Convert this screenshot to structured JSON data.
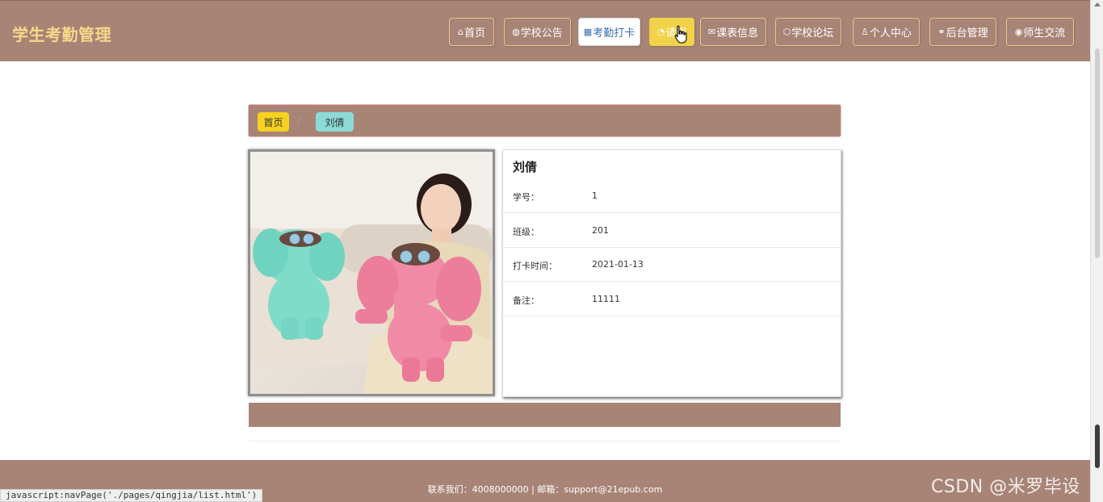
{
  "header": {
    "site_title": "学生考勤管理",
    "nav": [
      {
        "label": "首页",
        "icon": "home-icon",
        "glyph": "⌂",
        "state": "normal"
      },
      {
        "label": "学校公告",
        "icon": "globe-icon",
        "glyph": "◍",
        "state": "normal"
      },
      {
        "label": "考勤打卡",
        "icon": "calendar-icon",
        "glyph": "▦",
        "state": "active"
      },
      {
        "label": "请假",
        "icon": "gauge-icon",
        "glyph": "◔",
        "state": "hover"
      },
      {
        "label": "课表信息",
        "icon": "envelope-icon",
        "glyph": "✉",
        "state": "normal"
      },
      {
        "label": "学校论坛",
        "icon": "cube-icon",
        "glyph": "⬡",
        "state": "normal"
      },
      {
        "label": "个人中心",
        "icon": "user-icon",
        "glyph": "♙",
        "state": "normal"
      },
      {
        "label": "后台管理",
        "icon": "link-icon",
        "glyph": "⚭",
        "state": "normal"
      },
      {
        "label": "师生交流",
        "icon": "compass-icon",
        "glyph": "◉",
        "state": "normal"
      }
    ]
  },
  "breadcrumb": {
    "home": "首页",
    "separator": "/",
    "current": "刘倩"
  },
  "details": {
    "title": "刘倩",
    "rows": [
      {
        "label": "学号：",
        "value": "1"
      },
      {
        "label": "班级：",
        "value": "201"
      },
      {
        "label": "打卡时间：",
        "value": "2021-01-13"
      },
      {
        "label": "备注：",
        "value": "11111"
      }
    ]
  },
  "footer": {
    "text": "联系我们：4008000000 | 邮箱：support@21epub.com"
  },
  "status_bar": {
    "text": "javascript:navPage('./pages/qingjia/list.html')"
  },
  "watermark": {
    "text": "CSDN @米罗毕设"
  },
  "colors": {
    "theme_brown": "#a88476",
    "title_gold": "#f6d98a",
    "crumb_home": "#f6d120",
    "crumb_current": "#8bdad8",
    "nav_hover": "#f1d248",
    "nav_active_text": "#3a6fb0"
  }
}
